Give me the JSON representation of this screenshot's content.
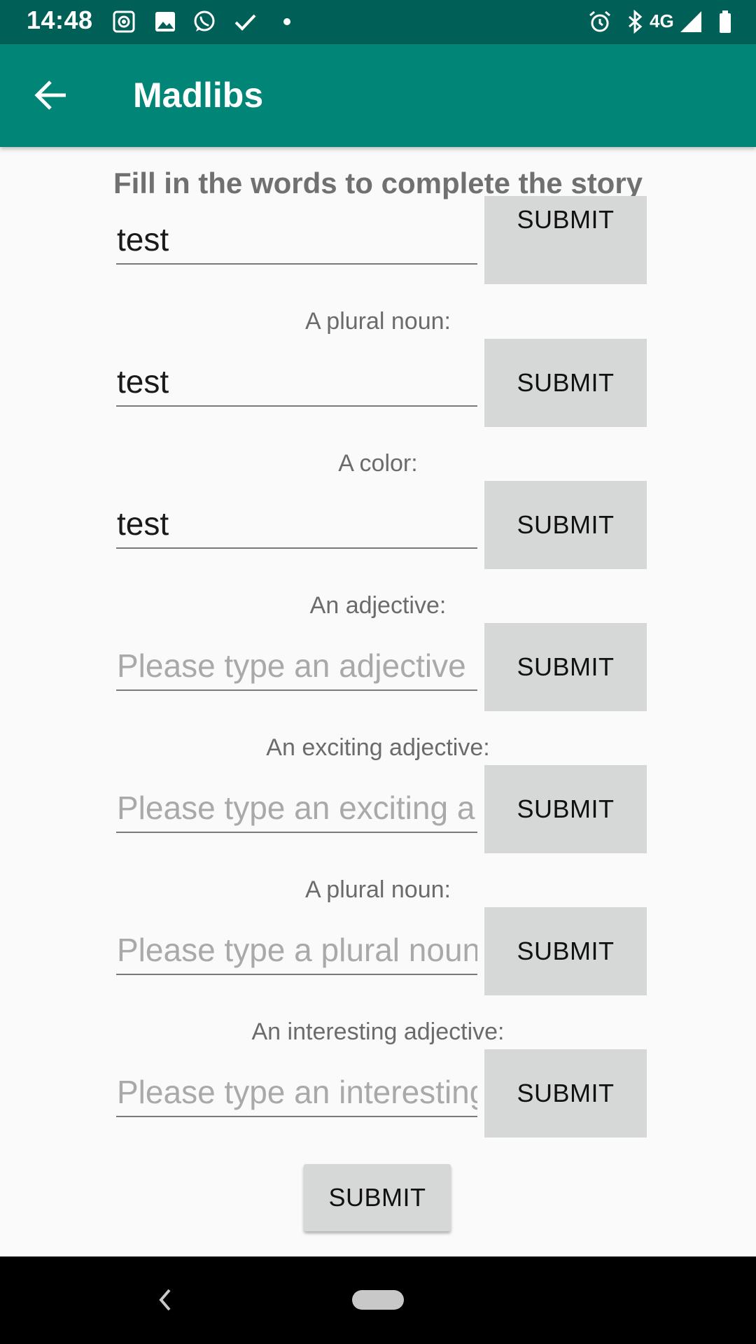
{
  "status_bar": {
    "time": "14:48",
    "network": "4G",
    "left_icons": [
      "screen-record-icon",
      "image-icon",
      "whatsapp-icon",
      "check-icon",
      "dot-icon"
    ],
    "right_icons": [
      "alarm-icon",
      "bluetooth-icon",
      "signal-icon",
      "battery-icon"
    ]
  },
  "app_bar": {
    "title": "Madlibs",
    "back_icon": "arrow-left-icon"
  },
  "heading": "Fill in the words to complete the story",
  "fields": [
    {
      "label": "",
      "value": "test",
      "placeholder": "",
      "button": "SUBMIT"
    },
    {
      "label": "A plural noun:",
      "value": "test",
      "placeholder": "",
      "button": "SUBMIT"
    },
    {
      "label": "A color:",
      "value": "test",
      "placeholder": "",
      "button": "SUBMIT"
    },
    {
      "label": "An adjective:",
      "value": "",
      "placeholder": "Please type an adjective",
      "button": "SUBMIT"
    },
    {
      "label": "An exciting adjective:",
      "value": "",
      "placeholder": "Please type an exciting a",
      "button": "SUBMIT"
    },
    {
      "label": "A plural noun:",
      "value": "",
      "placeholder": "Please type a plural noun",
      "button": "SUBMIT"
    },
    {
      "label": "An interesting adjective:",
      "value": "",
      "placeholder": "Please type an interesting",
      "button": "SUBMIT"
    }
  ],
  "final_submit": "SUBMIT",
  "colors": {
    "status_bar": "#005f56",
    "app_bar": "#008577",
    "button": "#d6d7d7"
  }
}
